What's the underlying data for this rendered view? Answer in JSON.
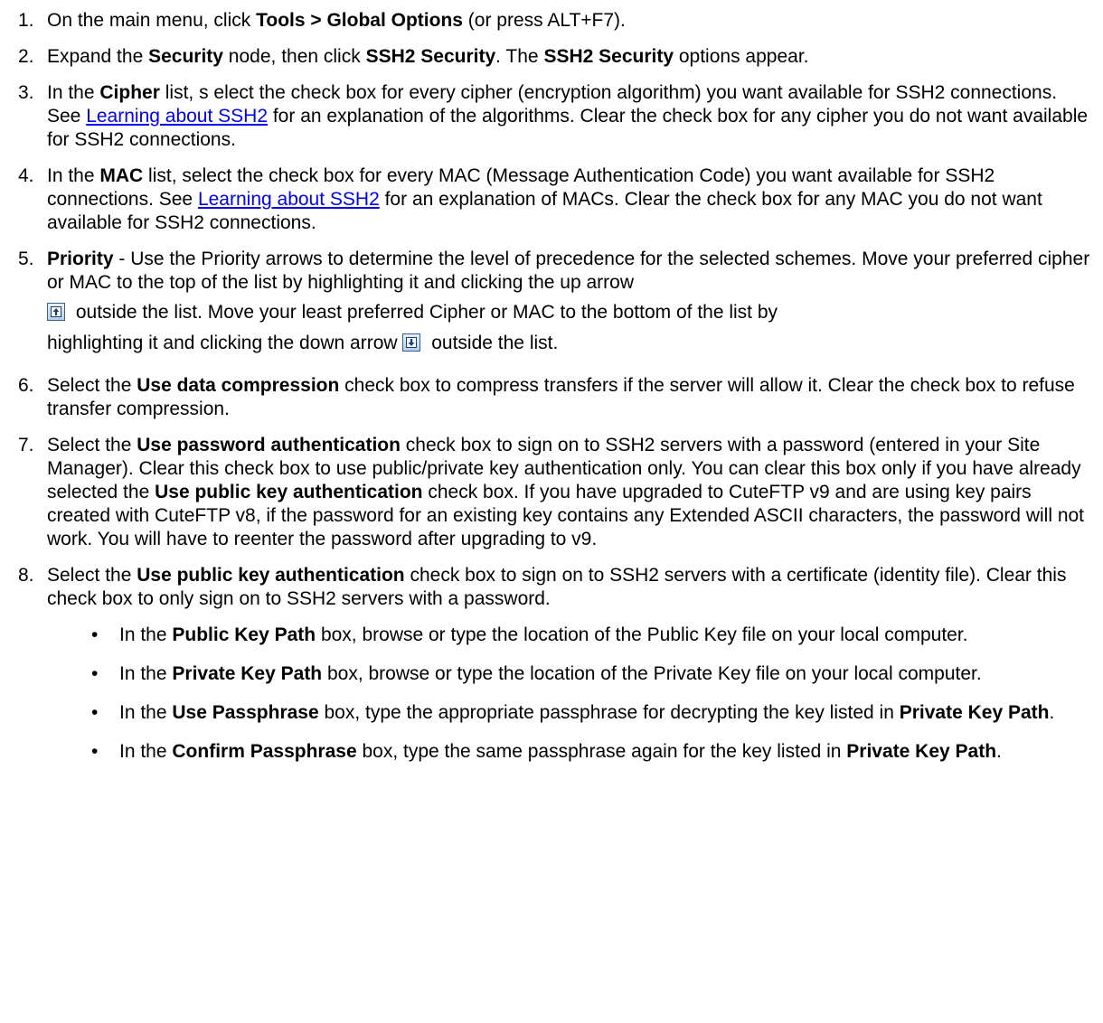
{
  "steps": [
    {
      "num": "1.",
      "parts": [
        "On the main menu, click ",
        "Tools > Global Options",
        " (or press ALT+F7)."
      ]
    },
    {
      "num": "2.",
      "parts": [
        "Expand the ",
        "Security",
        " node, then click ",
        "SSH2 Security",
        ". The ",
        "SSH2 Security",
        " options appear."
      ]
    },
    {
      "num": "3.",
      "parts": [
        "In the ",
        "Cipher",
        " list, s elect the check box for every cipher (encryption algorithm) you want available for SSH2 connections. See ",
        "Learning about SSH2",
        " for an explanation of the algorithms. Clear the check box for any cipher you do not want available for SSH2 connections."
      ]
    },
    {
      "num": "4.",
      "parts": [
        "In the ",
        "MAC",
        " list, select the check box for every MAC (Message Authentication Code) you want available for SSH2 connections. See ",
        "Learning about SSH2",
        " for an explanation of MACs. Clear the check box for any MAC you do not want available for SSH2 connections."
      ]
    },
    {
      "num": "5.",
      "parts": [
        "Priority",
        " - Use the Priority arrows to determine the level of precedence for the selected schemes. Move your preferred cipher or MAC to the top of the list by highlighting it and clicking the up arrow",
        " outside the list. Move your least preferred Cipher or MAC to the bottom of the list by",
        "highlighting it and clicking the down arrow ",
        " outside the list."
      ]
    },
    {
      "num": "6.",
      "parts": [
        "Select the ",
        "Use data compression",
        " check box to compress transfers if the server will allow it. Clear the check box to refuse transfer compression."
      ]
    },
    {
      "num": "7.",
      "parts": [
        "Select the ",
        "Use password authentication",
        " check box to sign on to SSH2 servers with a password (entered in your Site Manager). Clear this check box to use public/private key authentication only. You can clear this box only if you have already selected the ",
        "Use public key authentication",
        " check box. If you have upgraded to CuteFTP v9 and are using key pairs created with CuteFTP v8, if the password for an existing key contains any Extended ASCII characters, the password will not work. You will have to reenter the password after upgrading to v9."
      ]
    },
    {
      "num": "8.",
      "parts": [
        "Select the ",
        "Use public key authentication",
        " check box to sign on to SSH2 servers with a certificate (identity file). Clear this check box to only sign on to SSH2 servers with a password."
      ]
    }
  ],
  "bullets": [
    {
      "parts": [
        "In the ",
        "Public Key Path",
        " box, browse or type the location of the Public Key file on your local computer."
      ]
    },
    {
      "parts": [
        "In the ",
        "Private Key Path",
        " box, browse or type the location of the Private Key file on your local computer."
      ]
    },
    {
      "parts": [
        "In the ",
        "Use Passphrase",
        " box, type the appropriate passphrase for decrypting the key listed in ",
        "Private Key Path",
        "."
      ]
    },
    {
      "parts": [
        "In the ",
        "Confirm Passphrase",
        " box, type the same passphrase again for the key listed in ",
        "Private Key Path",
        "."
      ]
    }
  ],
  "bullet_char": "•",
  "icons": {
    "up_arrow": "up-arrow-icon",
    "down_arrow": "down-arrow-icon"
  },
  "colors": {
    "link": "#0000ee",
    "icon_border": "#35609a"
  }
}
